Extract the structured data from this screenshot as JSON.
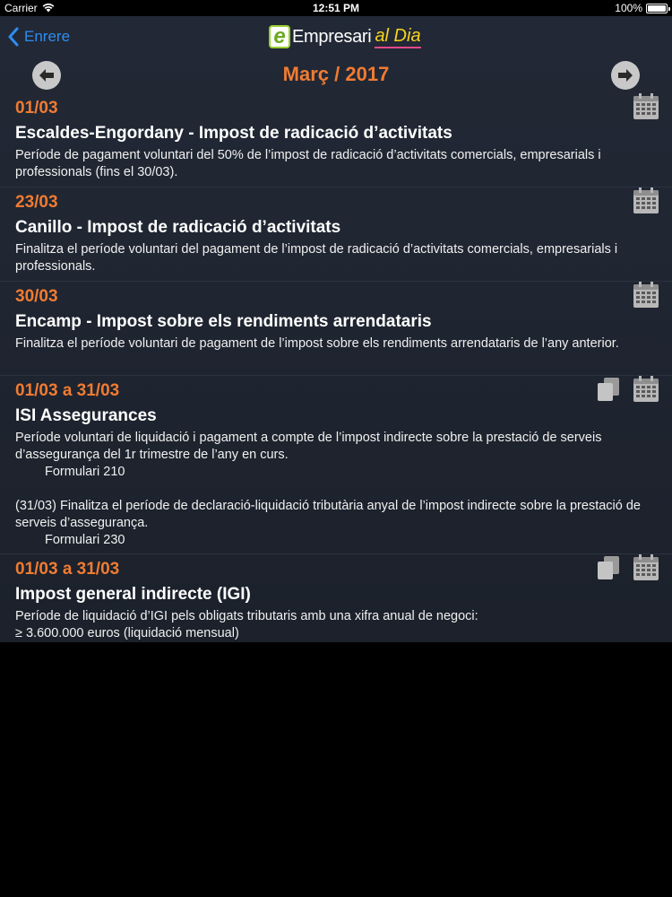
{
  "status_bar": {
    "carrier": "Carrier",
    "time": "12:51 PM",
    "battery": "100%"
  },
  "nav": {
    "back_label": "Enrere",
    "logo_text": "Empresari",
    "logo_accent": "al Dia"
  },
  "month": {
    "title": "Març / 2017"
  },
  "items": [
    {
      "date": "01/03",
      "title": "Escaldes-Engordany - Impost de radicació d’activitats",
      "desc": "Període de pagament voluntari del 50% de l’impost de radicació d’activitats comercials, empresarials i professionals (fins el 30/03)."
    },
    {
      "date": "23/03",
      "title": "Canillo - Impost de radicació d’activitats",
      "desc": "Finalitza el període voluntari del pagament de l’impost de radicació d’activitats comercials, empresarials i professionals."
    },
    {
      "date": "30/03",
      "title": "Encamp - Impost sobre els rendiments arrendataris",
      "desc": "Finalitza el període voluntari de pagament de l’impost sobre els rendiments arrendataris de l’any anterior."
    },
    {
      "date": "01/03 a 31/03",
      "title": "ISI Assegurances",
      "desc": "Període voluntari de liquidació i pagament a compte de l’impost indirecte sobre la prestació de serveis d’assegurança del 1r trimestre de l’any en curs.",
      "form": "Formulari 210",
      "desc2": "(31/03) Finalitza el període de declaració-liquidació tributària anyal de l’impost indirecte sobre la prestació de serveis d’assegurança.",
      "form2": "Formulari 230"
    },
    {
      "date": "01/03 a 31/03",
      "title": "Impost general indirecte (IGI)",
      "desc": "Període de liquidació d’IGI pels obligats tributaris amb una xifra anual de negoci:",
      "desc_line2": "≥ 3.600.000 euros (liquidació mensual)"
    }
  ]
}
